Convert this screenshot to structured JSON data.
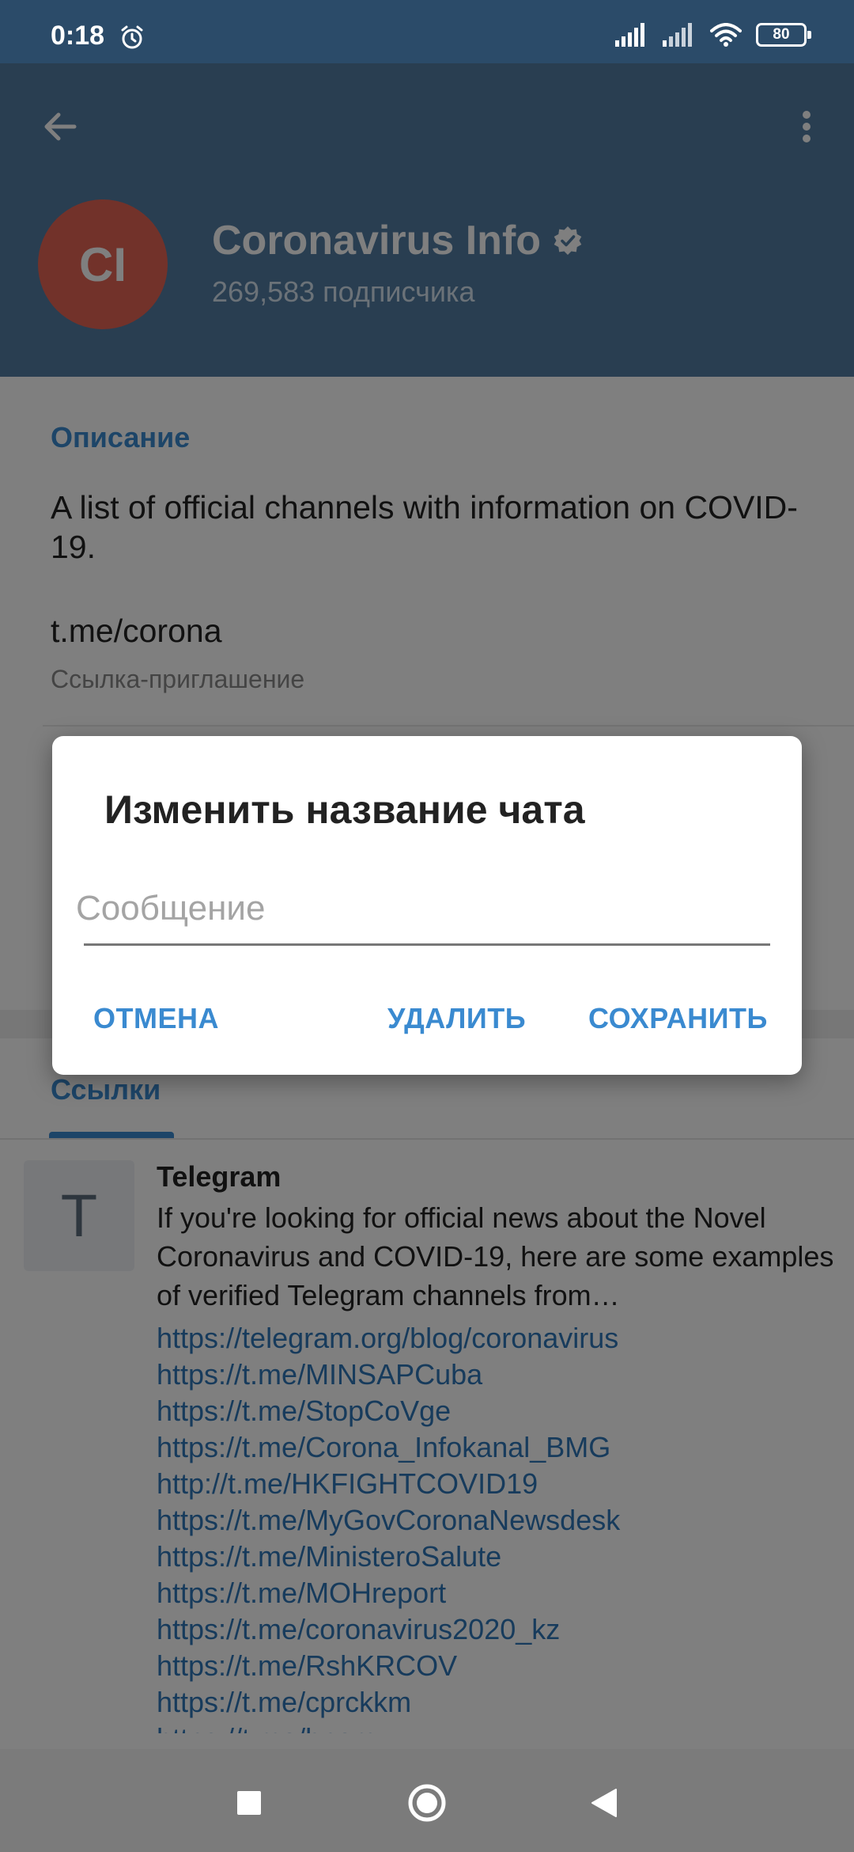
{
  "status_bar": {
    "time": "0:18",
    "battery": "80",
    "icons": [
      "alarm-icon",
      "signal-icon",
      "signal-icon",
      "wifi-icon",
      "battery-icon"
    ]
  },
  "header": {
    "back_icon": "arrow-left-icon",
    "menu_icon": "more-vertical-icon",
    "avatar_initials": "CI",
    "avatar_color": "#e56555",
    "title": "Coronavirus Info",
    "verified_icon": "verified-badge-icon",
    "subscribers": "269,583 подписчика",
    "background_color": "#527da3"
  },
  "info": {
    "section_title": "Описание",
    "description": "A list of official channels with information on COVID-19.",
    "link": "t.me/corona",
    "link_caption": "Ссылка-приглашение"
  },
  "links_section": {
    "title": "Ссылки",
    "item": {
      "thumb_letter": "T",
      "title": "Telegram",
      "description": "If you're looking for official news about the Novel Coronavirus and COVID-19, here are some examples of verified Telegram channels from…",
      "urls": [
        "https://telegram.org/blog/coronavirus",
        "https://t.me/MINSAPCuba",
        "https://t.me/StopCoVge",
        "https://t.me/Corona_Infokanal_BMG",
        "http://t.me/HKFIGHTCOVID19",
        "https://t.me/MyGovCoronaNewsdesk",
        "https://t.me/MinisteroSalute",
        "https://t.me/MOHreport",
        "https://t.me/coronavirus2020_kz",
        "https://t.me/RshKRCOV",
        "https://t.me/cprckkm",
        "https://t.me/hnemy"
      ]
    }
  },
  "dialog": {
    "title": "Изменить название чата",
    "input_value": "",
    "input_placeholder": "Сообщение",
    "cancel_label": "ОТМЕНА",
    "delete_label": "УДАЛИТЬ",
    "save_label": "СОХРАНИТЬ",
    "accent_color": "#3a8ad0"
  },
  "nav_bar": {
    "icons": [
      "recents-square-icon",
      "home-circle-icon",
      "back-triangle-icon"
    ]
  }
}
